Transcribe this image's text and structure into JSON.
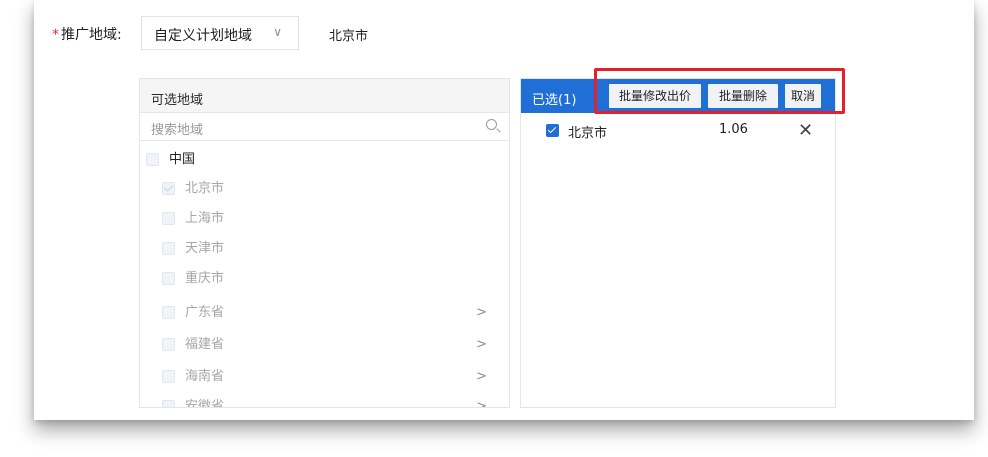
{
  "form": {
    "required_mark": "*",
    "label": "推广地域:",
    "select_value": "自定义计划地域",
    "select_icon": "chevron-down-icon",
    "selected_summary": "北京市"
  },
  "left": {
    "header": "可选地域",
    "search_placeholder": "搜索地域",
    "tree": [
      {
        "label": "中国",
        "checked": false
      },
      {
        "label": "北京市",
        "checked": true
      },
      {
        "label": "上海市",
        "checked": false
      },
      {
        "label": "天津市",
        "checked": false
      },
      {
        "label": "重庆市",
        "checked": false
      },
      {
        "label": "广东省",
        "checked": false,
        "expandable": true
      },
      {
        "label": "福建省",
        "checked": false,
        "expandable": true
      },
      {
        "label": "海南省",
        "checked": false,
        "expandable": true
      },
      {
        "label": "安徽省",
        "checked": false,
        "expandable": true
      }
    ]
  },
  "right": {
    "header": "已选(1)",
    "buttons": {
      "batch_price": "批量修改出价",
      "batch_delete": "批量删除",
      "cancel": "取消"
    },
    "selected": [
      {
        "name": "北京市",
        "price": "1.06"
      }
    ],
    "accent_color": "#1f6fd6",
    "highlight_color": "#e61f2a"
  }
}
